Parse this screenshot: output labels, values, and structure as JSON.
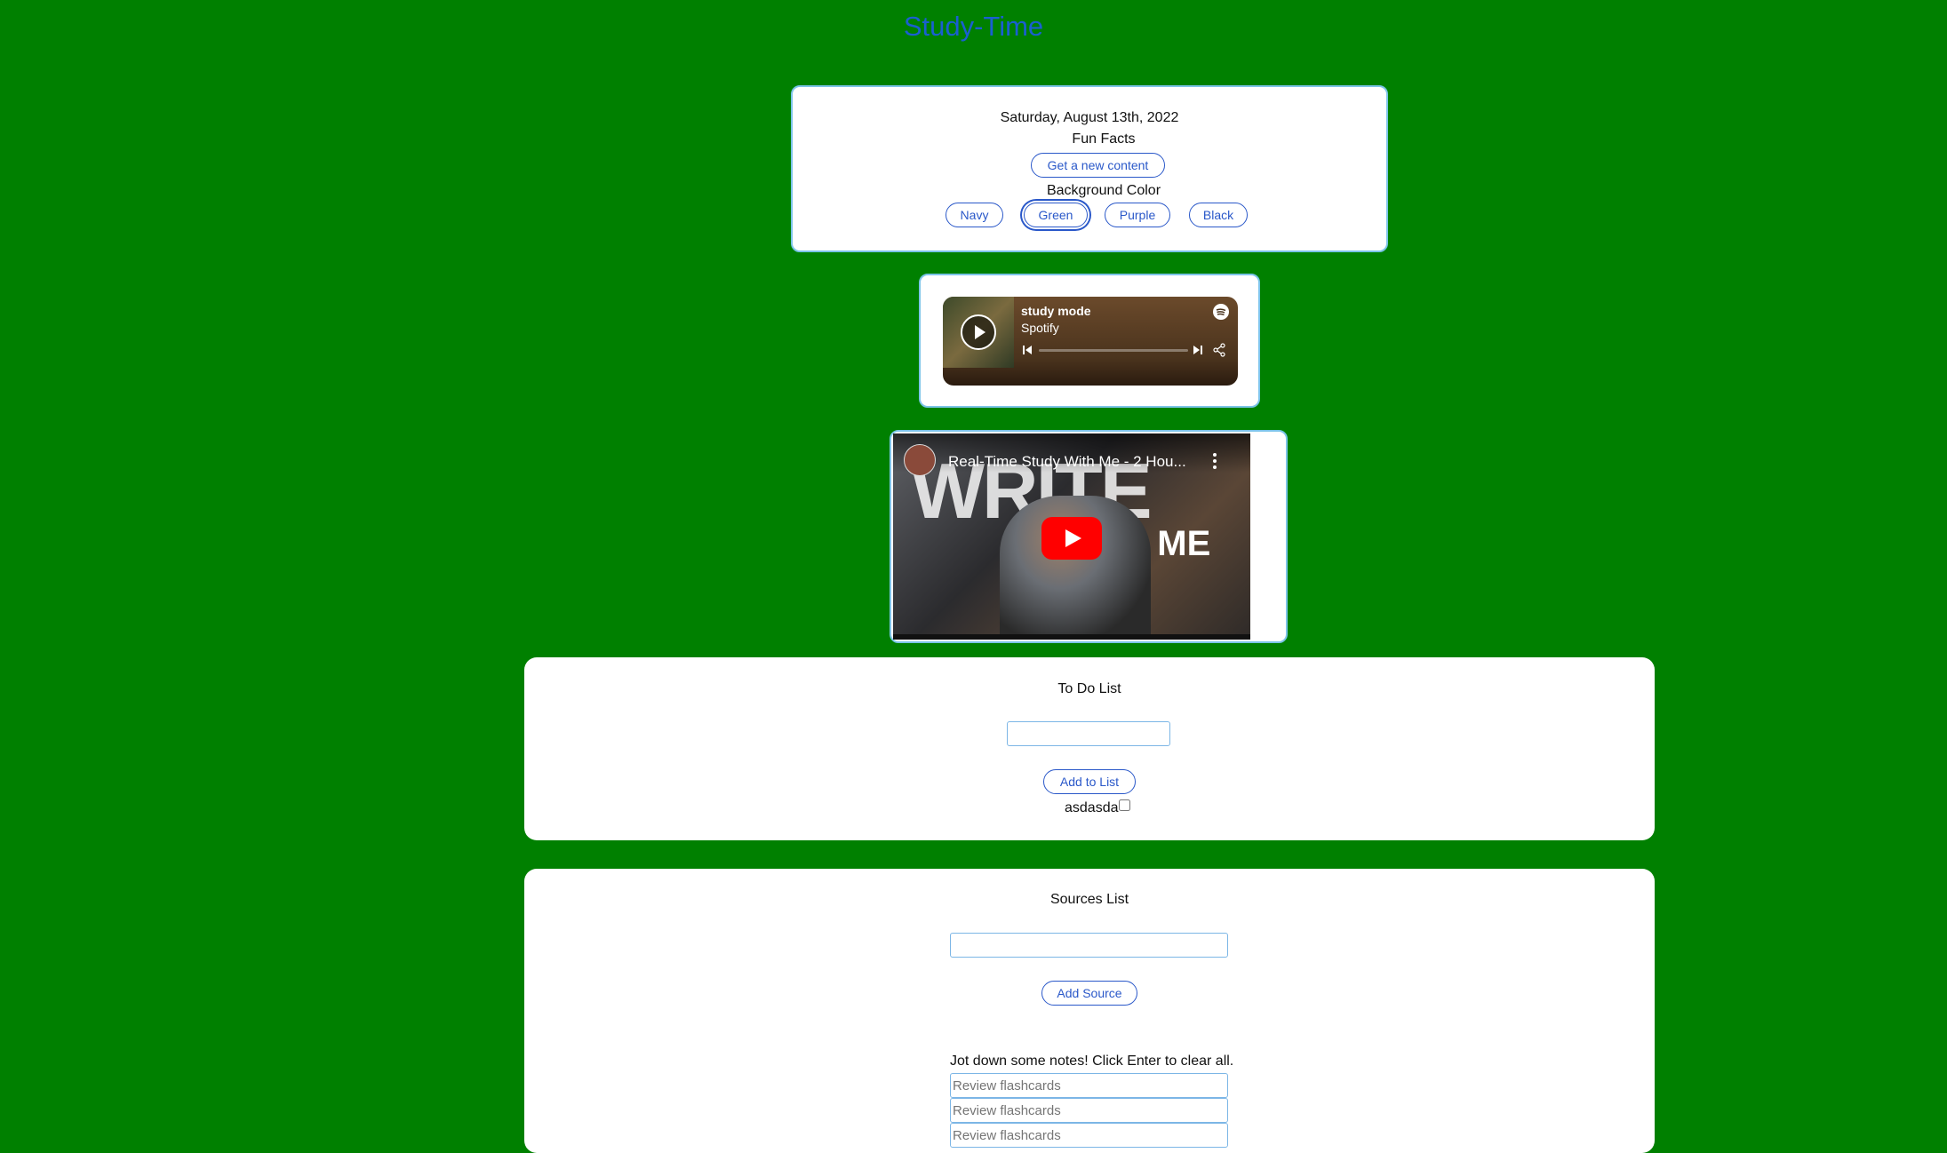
{
  "header": {
    "title": "Study-Time"
  },
  "top_card": {
    "date": "Saturday, August 13th, 2022",
    "fun_facts_label": "Fun Facts",
    "new_content_button": "Get a new content",
    "bg_color_label": "Background Color",
    "color_buttons": [
      "Navy",
      "Green",
      "Purple",
      "Black"
    ],
    "active_color": "Green"
  },
  "spotify": {
    "playlist": "study mode",
    "source": "Spotify"
  },
  "youtube": {
    "video_title": "Real-Time Study With Me - 2 Hou...",
    "thumb_text_1": "WRITE",
    "thumb_text_2": "WITH ME"
  },
  "todo": {
    "heading": "To Do List",
    "add_button": "Add to List",
    "items": [
      {
        "label": "asdasda",
        "checked": false
      }
    ]
  },
  "sources": {
    "heading": "Sources List",
    "add_button": "Add Source",
    "notes_instructions": "Jot down some notes! Click Enter to clear all.",
    "notes": [
      {
        "placeholder": "Review flashcards"
      },
      {
        "placeholder": "Review flashcards"
      },
      {
        "placeholder": "Review flashcards"
      }
    ]
  },
  "colors": {
    "background": "#008000",
    "accent": "#2a58c9",
    "title": "#1a5fd1"
  }
}
